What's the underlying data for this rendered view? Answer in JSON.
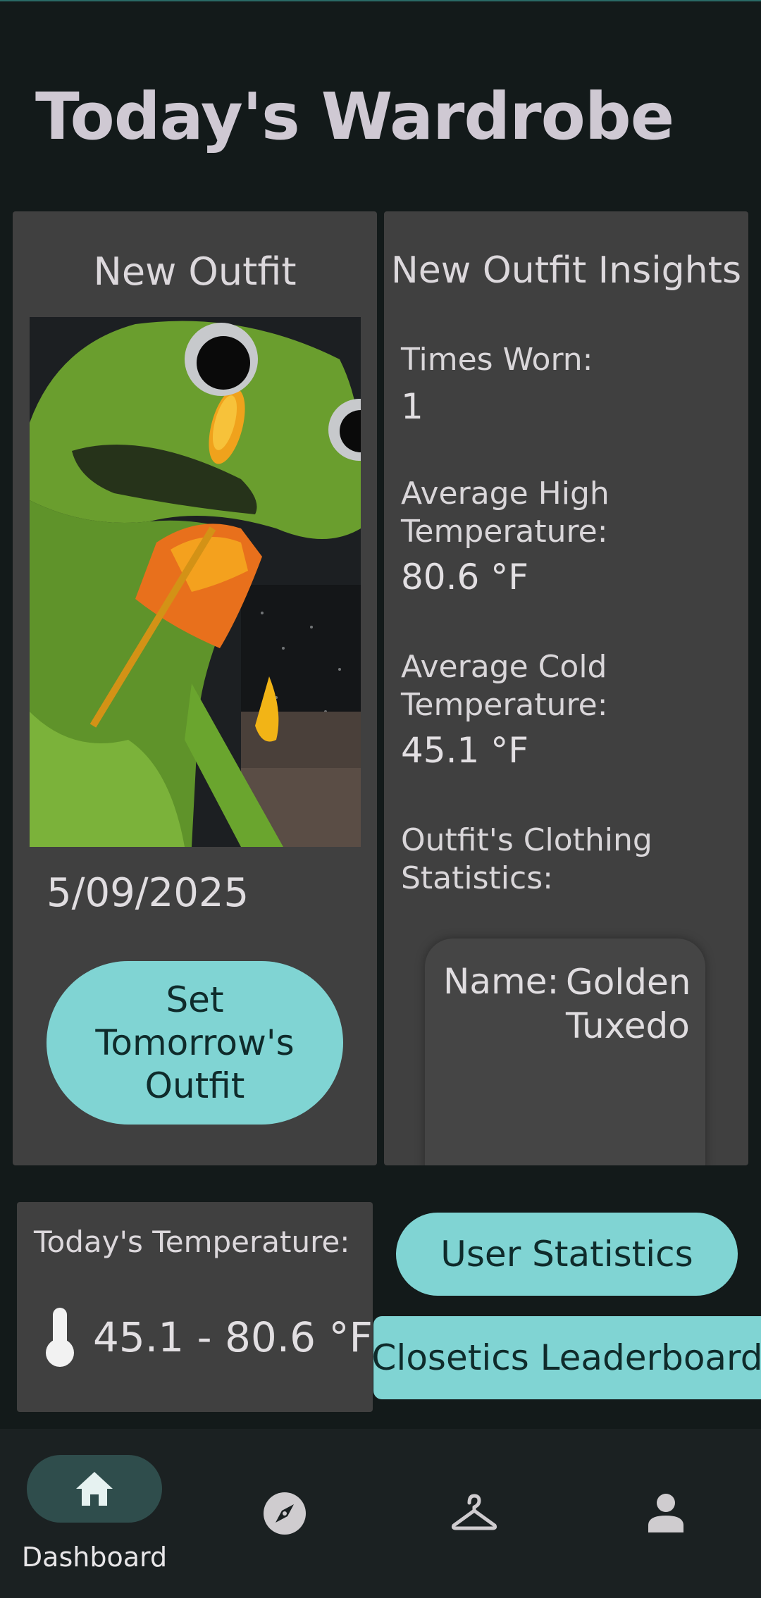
{
  "header": {
    "title": "Today's Wardrobe"
  },
  "outfit_card": {
    "heading": "New Outfit",
    "date": "5/09/2025",
    "set_button_label": "Set Tomorrow's Outfit"
  },
  "insights_card": {
    "heading": "New Outfit Insights",
    "times_worn_label": "Times Worn:",
    "times_worn_value": "1",
    "avg_high_label": "Average High Temperature:",
    "avg_high_value": "80.6 °F",
    "avg_cold_label": "Average Cold Temperature:",
    "avg_cold_value": "45.1 °F",
    "clothing_stats_label": "Outfit's Clothing Statistics:",
    "clothing_item": {
      "name_label": "Name:",
      "name_value": "Golden Tuxedo"
    }
  },
  "temperature_card": {
    "label": "Today's Temperature:",
    "value": "45.1 - 80.6 °F",
    "icon": "thermometer-icon"
  },
  "actions": {
    "user_statistics_label": "User Statistics",
    "leaderboard_label": "Closetics Leaderboard"
  },
  "navbar": {
    "items": [
      {
        "label": "Dashboard",
        "icon": "home-icon",
        "active": true
      },
      {
        "label": "",
        "icon": "compass-icon",
        "active": false
      },
      {
        "label": "",
        "icon": "hanger-icon",
        "active": false
      },
      {
        "label": "",
        "icon": "person-icon",
        "active": false
      }
    ]
  },
  "colors": {
    "background": "#131a1a",
    "card": "#404040",
    "accent": "#80d4d3",
    "nav_active": "#2f4d4c"
  }
}
